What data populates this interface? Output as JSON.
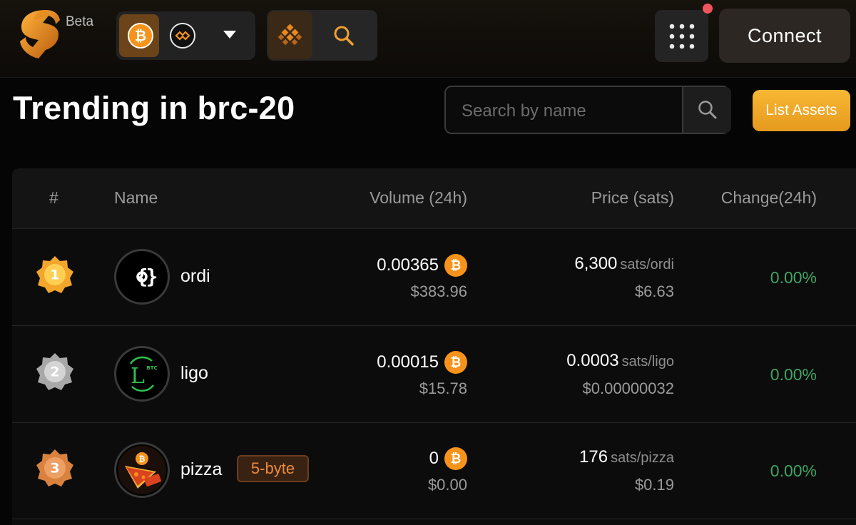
{
  "header": {
    "beta_label": "Beta",
    "connect_label": "Connect"
  },
  "page": {
    "title": "Trending in brc-20",
    "search_placeholder": "Search by name",
    "list_assets_label": "List Assets"
  },
  "table": {
    "columns": [
      "#",
      "Name",
      "Volume (24h)",
      "Price (sats)",
      "Change(24h)"
    ],
    "rows": [
      {
        "rank": "1",
        "name": "ordi",
        "badge": "",
        "volume_btc": "0.00365",
        "volume_usd": "$383.96",
        "price_sats": "6,300",
        "price_unit": "sats/ordi",
        "price_usd": "$6.63",
        "change": "0.00%"
      },
      {
        "rank": "2",
        "name": "ligo",
        "badge": "",
        "volume_btc": "0.00015",
        "volume_usd": "$15.78",
        "price_sats": "0.0003",
        "price_unit": "sats/ligo",
        "price_usd": "$0.00000032",
        "change": "0.00%"
      },
      {
        "rank": "3",
        "name": "pizza",
        "badge": "5-byte",
        "volume_btc": "0",
        "volume_usd": "$0.00",
        "price_sats": "176",
        "price_unit": "sats/pizza",
        "price_usd": "$0.19",
        "change": "0.00%"
      }
    ]
  },
  "colors": {
    "accent": "#f7931a",
    "positive": "#3fa564",
    "badge_text": "#e98b3c"
  }
}
